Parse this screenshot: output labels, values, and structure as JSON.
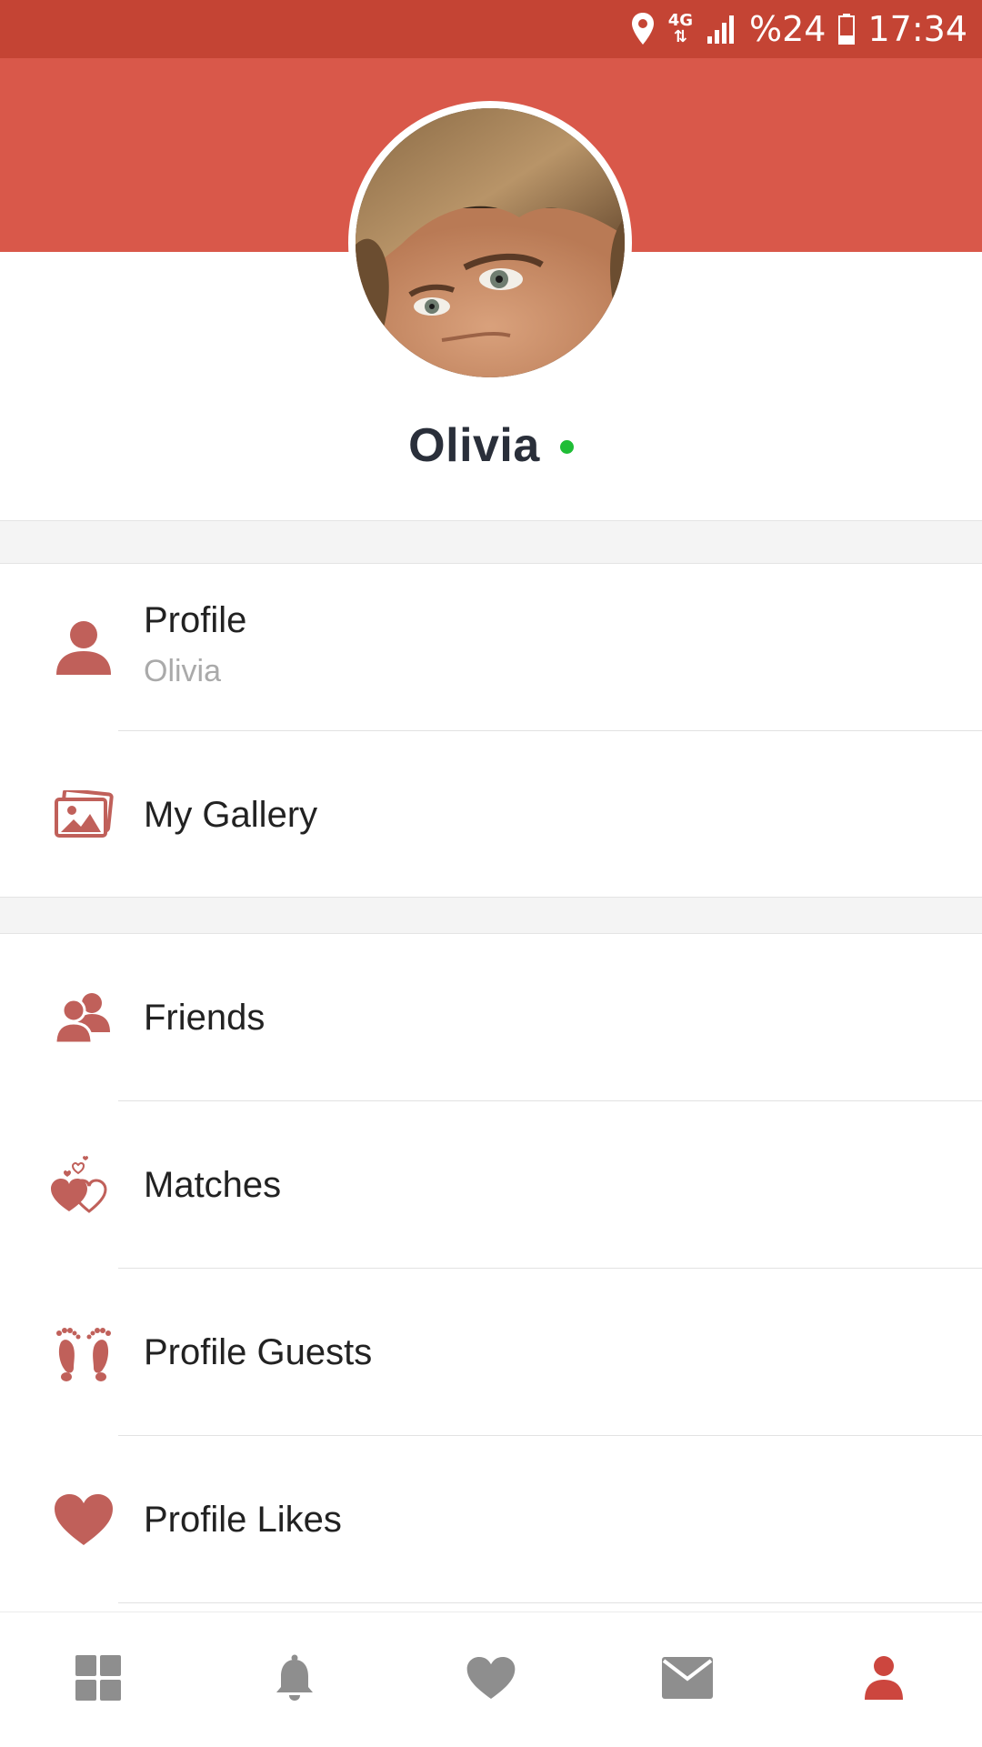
{
  "status_bar": {
    "battery_text": "%24",
    "time": "17:34",
    "network": "4G",
    "icons": [
      "location-icon",
      "network-4g-icon",
      "signal-icon",
      "battery-icon"
    ]
  },
  "profile": {
    "name": "Olivia",
    "online": true
  },
  "menu": {
    "profile": {
      "label": "Profile",
      "sub": "Olivia",
      "icon": "person-icon"
    },
    "gallery": {
      "label": "My Gallery",
      "icon": "gallery-icon"
    },
    "friends": {
      "label": "Friends",
      "icon": "friends-icon"
    },
    "matches": {
      "label": "Matches",
      "icon": "matches-hearts-icon"
    },
    "guests": {
      "label": "Profile Guests",
      "icon": "footprints-icon"
    },
    "likes": {
      "label": "Profile Likes",
      "icon": "heart-icon"
    }
  },
  "tab_bar": {
    "tabs": [
      {
        "icon": "dashboard-icon",
        "active": false
      },
      {
        "icon": "bell-icon",
        "active": false
      },
      {
        "icon": "heart-icon",
        "active": false
      },
      {
        "icon": "mail-icon",
        "active": false
      },
      {
        "icon": "person-icon",
        "active": true
      }
    ]
  },
  "colors": {
    "status_bar": "#c44434",
    "header": "#d9584a",
    "icon_accent": "#c0605a",
    "active_tab": "#cc463e",
    "inactive_tab": "#8e8e8e",
    "online": "#1fbd36"
  }
}
